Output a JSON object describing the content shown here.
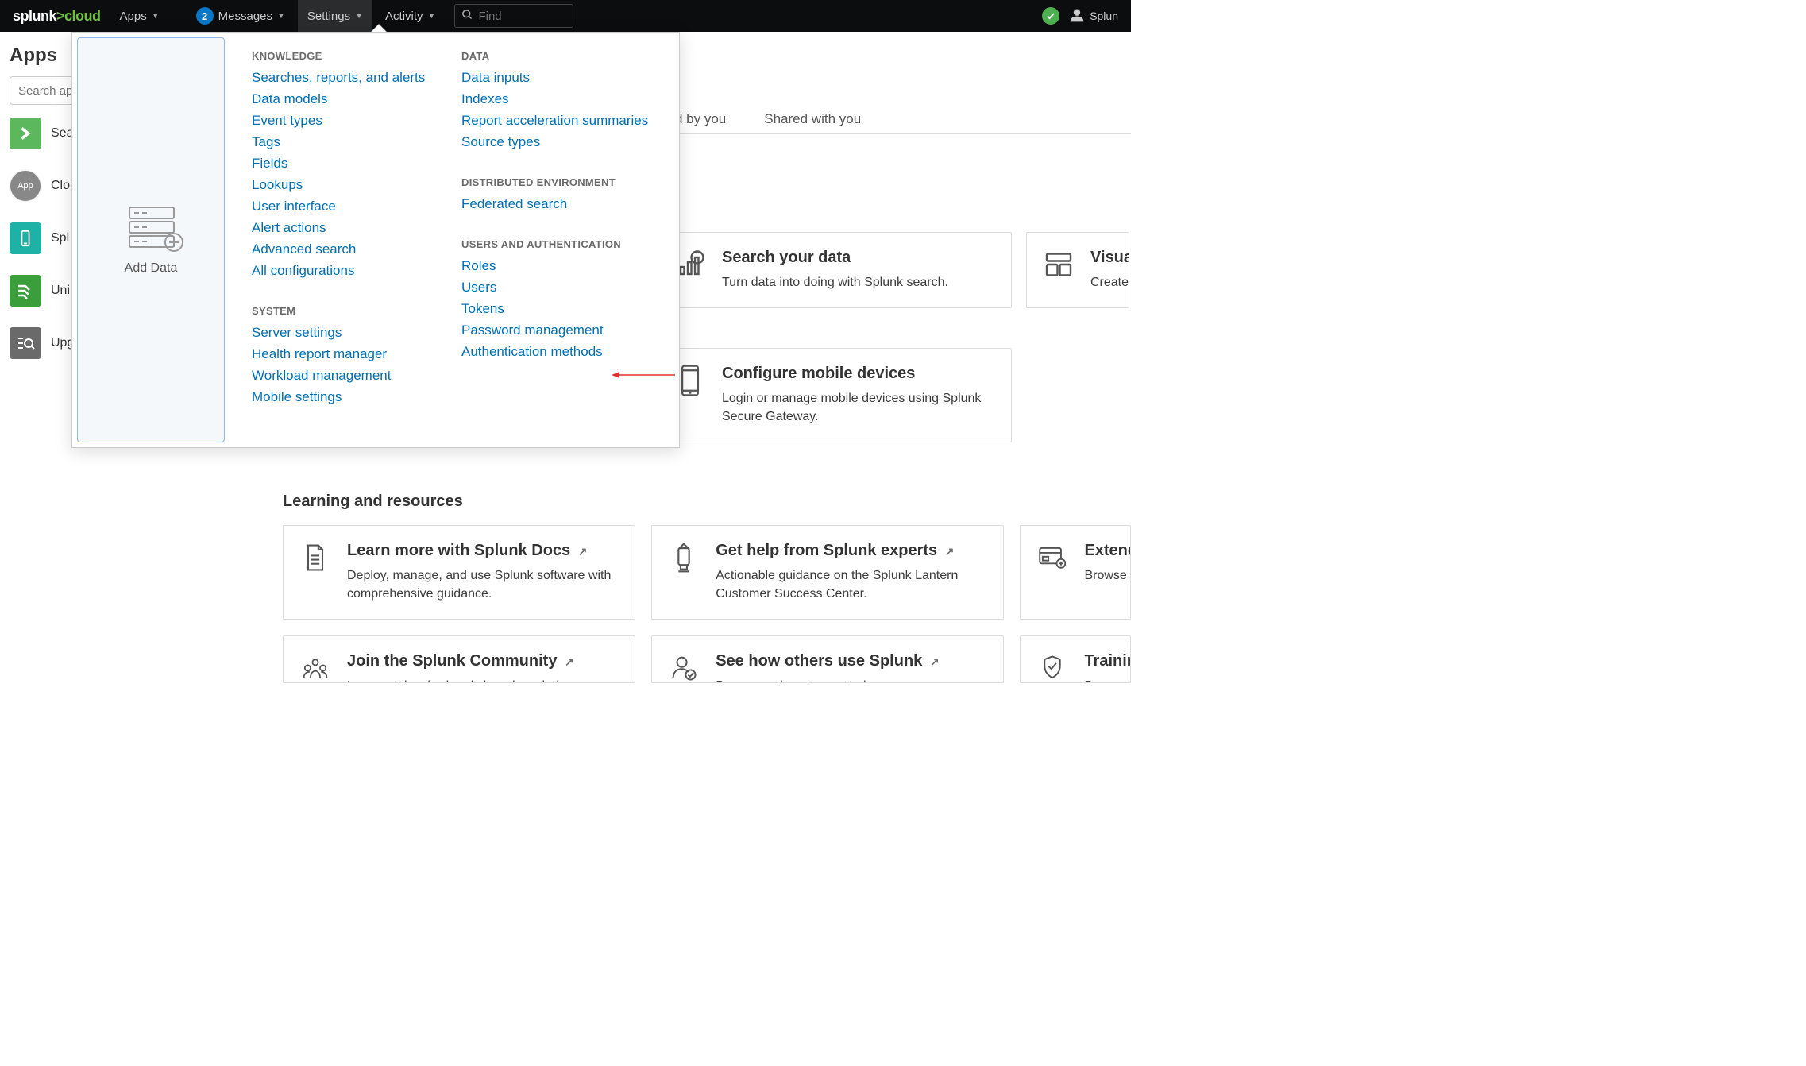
{
  "topnav": {
    "logo_part1": "splunk",
    "logo_gt": ">",
    "logo_part2": "cloud",
    "apps": "Apps",
    "messages_badge": "2",
    "messages": "Messages",
    "settings": "Settings",
    "activity": "Activity",
    "find_placeholder": "Find",
    "user": "Splun"
  },
  "sidebar": {
    "title": "Apps",
    "search_placeholder": "Search ap",
    "items": [
      {
        "label": "Sea"
      },
      {
        "label": "Clou"
      },
      {
        "label": "Spl"
      },
      {
        "label": "Uni"
      },
      {
        "label": "Upg"
      }
    ]
  },
  "dropdown": {
    "add_data": "Add Data",
    "knowledge": {
      "title": "KNOWLEDGE",
      "items": [
        "Searches, reports, and alerts",
        "Data models",
        "Event types",
        "Tags",
        "Fields",
        "Lookups",
        "User interface",
        "Alert actions",
        "Advanced search",
        "All configurations"
      ]
    },
    "system": {
      "title": "SYSTEM",
      "items": [
        "Server settings",
        "Health report manager",
        "Workload management",
        "Mobile settings"
      ]
    },
    "data": {
      "title": "DATA",
      "items": [
        "Data inputs",
        "Indexes",
        "Report acceleration summaries",
        "Source types"
      ]
    },
    "distributed": {
      "title": "DISTRIBUTED ENVIRONMENT",
      "items": [
        "Federated search"
      ]
    },
    "users_auth": {
      "title": "USERS AND AUTHENTICATION",
      "items": [
        "Roles",
        "Users",
        "Tokens",
        "Password management",
        "Authentication methods"
      ]
    }
  },
  "tabs": {
    "t1": "d by you",
    "t2": "Shared with you"
  },
  "cards": {
    "search": {
      "title": "Search your data",
      "desc": "Turn data into doing with Splunk search."
    },
    "visualize": {
      "title": "Visualiz",
      "desc": "Create d"
    },
    "mobile": {
      "title": "Configure mobile devices",
      "desc": "Login or manage mobile devices using Splunk Secure Gateway."
    }
  },
  "learning": {
    "title": "Learning and resources",
    "docs": {
      "title": "Learn more with Splunk Docs",
      "desc": "Deploy, manage, and use Splunk software with comprehensive guidance."
    },
    "help": {
      "title": "Get help from Splunk experts",
      "desc": "Actionable guidance on the Splunk Lantern Customer Success Center."
    },
    "extend": {
      "title": "Extend",
      "desc": "Browse t"
    },
    "community": {
      "title": "Join the Splunk Community",
      "desc": "Learn  get inspired  and share knowledge"
    },
    "others": {
      "title": "See how others use Splunk",
      "desc": "Browse real customer stories"
    },
    "training": {
      "title": "Training",
      "desc": "Become"
    }
  }
}
